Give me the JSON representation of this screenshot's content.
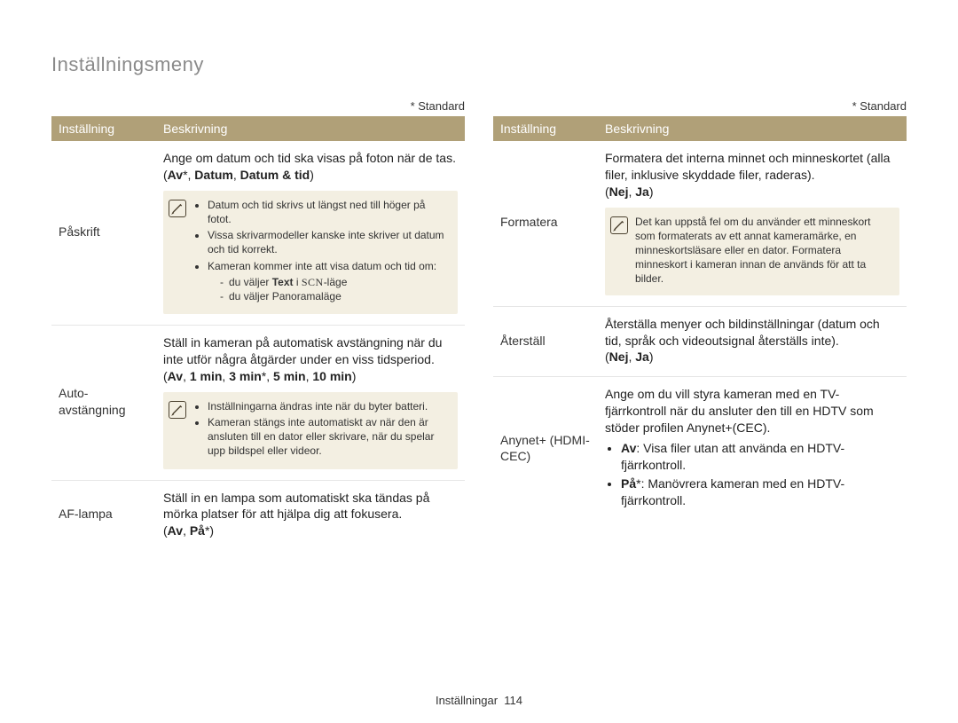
{
  "title": "Inställningsmeny",
  "standard_label": "* Standard",
  "column_headers": {
    "setting": "Inställning",
    "description": "Beskrivning"
  },
  "left": {
    "rows": [
      {
        "label": "Påskrift",
        "intro_a": "Ange om datum och tid ska visas på foton när de tas. (",
        "intro_b": "Av",
        "intro_star": "*, ",
        "intro_c": "Datum",
        "intro_sep": ", ",
        "intro_d": "Datum & tid",
        "intro_e": ")",
        "note_items": [
          "Datum och tid skrivs ut längst ned till höger på fotot.",
          "Vissa skrivarmodeller kanske inte skriver ut datum och tid korrekt.",
          "Kameran kommer inte att visa datum och tid om:"
        ],
        "note_sub": [
          {
            "pre": "du väljer ",
            "bold": "Text",
            "mid": " i ",
            "scn": "SCN",
            "post": "-läge"
          },
          {
            "pre": "du väljer Panoramaläge"
          }
        ]
      },
      {
        "label": "Auto-avstängning",
        "intro_a": "Ställ in kameran på automatisk avstängning när du inte utför några åtgärder under en viss tidsperiod.",
        "opts_a": "(",
        "opts_b": "Av",
        "opts_sep1": ", ",
        "opts_c": "1 min",
        "opts_sep2": ", ",
        "opts_d": "3 min",
        "opts_star": "*, ",
        "opts_e": "5 min",
        "opts_sep3": ", ",
        "opts_f": "10 min",
        "opts_g": ")",
        "note_items": [
          "Inställningarna ändras inte när du byter batteri.",
          "Kameran stängs inte automatiskt av när den är ansluten till en dator eller skrivare, när du spelar upp bildspel eller videor."
        ]
      },
      {
        "label": "AF-lampa",
        "intro_a": "Ställ in en lampa som automatiskt ska tändas på mörka platser för att hjälpa dig att fokusera.",
        "opts_a": "(",
        "opts_b": "Av",
        "opts_sep1": ", ",
        "opts_c": "På",
        "opts_star": "*)",
        "opts_d": ""
      }
    ]
  },
  "right": {
    "rows": [
      {
        "label": "Formatera",
        "intro_a": "Formatera det interna minnet och minneskortet (alla filer, inklusive skyddade filer, raderas).",
        "opts_a": "(",
        "opts_b": "Nej",
        "opts_sep1": ", ",
        "opts_c": "Ja",
        "opts_d": ")",
        "note_text": "Det kan uppstå fel om du använder ett minneskort som formaterats av ett annat kameramärke, en minneskortsläsare eller en dator. Formatera minneskort i kameran innan de används för att ta bilder."
      },
      {
        "label": "Återställ",
        "intro_a": "Återställa menyer och bildinställningar (datum och tid, språk och videoutsignal återställs inte).",
        "opts_a": "(",
        "opts_b": "Nej",
        "opts_sep1": ", ",
        "opts_c": "Ja",
        "opts_d": ")"
      },
      {
        "label": "Anynet+ (HDMI-CEC)",
        "intro_a": "Ange om du vill styra kameran med en TV-fjärrkontroll när du ansluter den till en HDTV som stöder profilen Anynet+(CEC).",
        "bullets": [
          {
            "b": "Av",
            "rest": ": Visa filer utan att använda en HDTV-fjärrkontroll."
          },
          {
            "b": "På",
            "star": "*",
            "rest": ": Manövrera kameran med en HDTV-fjärrkontroll."
          }
        ]
      }
    ]
  },
  "footer": {
    "label": "Inställningar",
    "page": "114"
  }
}
